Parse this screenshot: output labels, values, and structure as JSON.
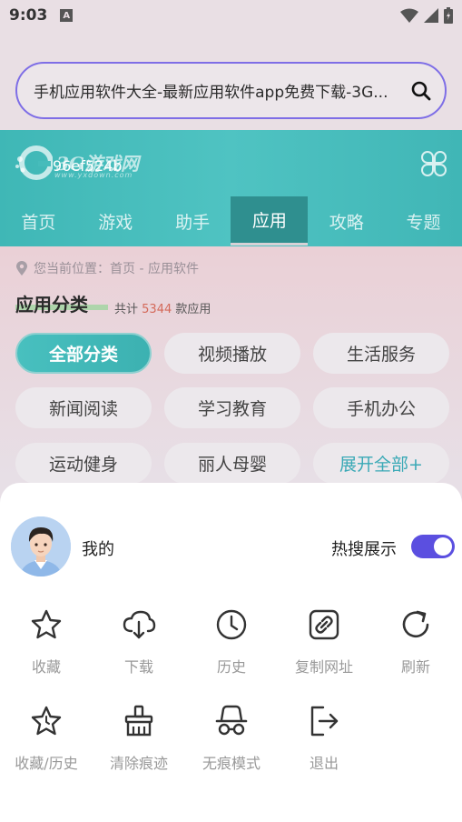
{
  "status_bar": {
    "time": "9:03",
    "badge": "A"
  },
  "url_bar": {
    "text": "手机应用软件大全-最新应用软件app免费下载-3G..."
  },
  "site": {
    "logo_text": "3G游戏网",
    "logo_overlay": "96ef524b",
    "logo_sub": "www.yxdown.com",
    "nav": [
      "首页",
      "游戏",
      "助手",
      "应用",
      "攻略",
      "专题"
    ]
  },
  "content": {
    "breadcrumb": "您当前位置：首页 - 应用软件",
    "section_title": "应用分类",
    "total_prefix": "共计",
    "total_count": "5344",
    "total_suffix": "款应用",
    "chips": [
      "全部分类",
      "视频播放",
      "生活服务",
      "新闻阅读",
      "学习教育",
      "手机办公",
      "运动健身",
      "丽人母婴",
      "展开全部+"
    ]
  },
  "sheet": {
    "my_label": "我的",
    "hot_label": "热搜展示",
    "toggle_on": true,
    "menu_row1": [
      {
        "label": "收藏",
        "icon": "star-icon"
      },
      {
        "label": "下载",
        "icon": "cloud-download-icon"
      },
      {
        "label": "历史",
        "icon": "clock-icon"
      },
      {
        "label": "复制网址",
        "icon": "link-icon"
      },
      {
        "label": "刷新",
        "icon": "refresh-icon"
      }
    ],
    "menu_row2": [
      {
        "label": "收藏/历史",
        "icon": "star-history-icon"
      },
      {
        "label": "清除痕迹",
        "icon": "broom-icon"
      },
      {
        "label": "无痕模式",
        "icon": "incognito-icon"
      },
      {
        "label": "退出",
        "icon": "logout-icon"
      }
    ]
  },
  "colors": {
    "accent": "#5b4fe0",
    "teal": "#3fb7b6",
    "url_border": "#7e6ee6"
  }
}
